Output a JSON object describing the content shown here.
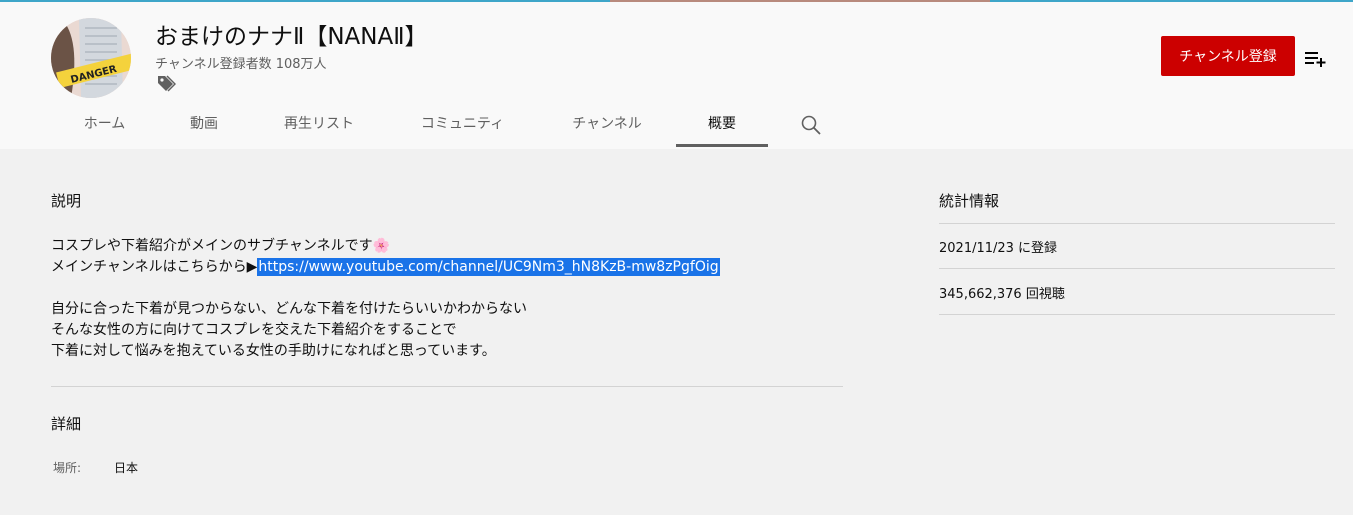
{
  "channel": {
    "title": "おまけのナナⅡ【NANAⅡ】",
    "subscribers": "チャンネル登録者数 108万人",
    "avatar_badge": "DANGER"
  },
  "header": {
    "subscribe_label": "チャンネル登録",
    "icons": [
      "tag-icon",
      "playlist-add-icon",
      "search-icon"
    ]
  },
  "tabs": [
    {
      "label": "ホーム"
    },
    {
      "label": "動画"
    },
    {
      "label": "再生リスト"
    },
    {
      "label": "コミュニティ"
    },
    {
      "label": "チャンネル"
    },
    {
      "label": "概要",
      "active": true
    }
  ],
  "about": {
    "description_heading": "説明",
    "lines": [
      "コスプレや下着紹介がメインのサブチャンネルです🌸",
      "メインチャンネルはこちらから▶",
      "自分に合った下着が見つからない、どんな下着を付けたらいいかわからない",
      "そんな女性の方に向けてコスプレを交えた下着紹介をすることで",
      "下着に対して悩みを抱えている女性の手助けになればと思っています。"
    ],
    "link": "https://www.youtube.com/channel/UC9Nm3_hN8KzB-mw8zPgfOig",
    "details_heading": "詳細",
    "location_key": "場所:",
    "location_value": "日本"
  },
  "stats": {
    "heading": "統計情報",
    "joined": "2021/11/23 に登録",
    "views": "345,662,376 回視聴"
  },
  "colors": {
    "subscribe": "#cc0000",
    "link_highlight": "#1a73e8",
    "page_bg": "#f1f1f1",
    "header_bg": "#f9f9f9"
  }
}
